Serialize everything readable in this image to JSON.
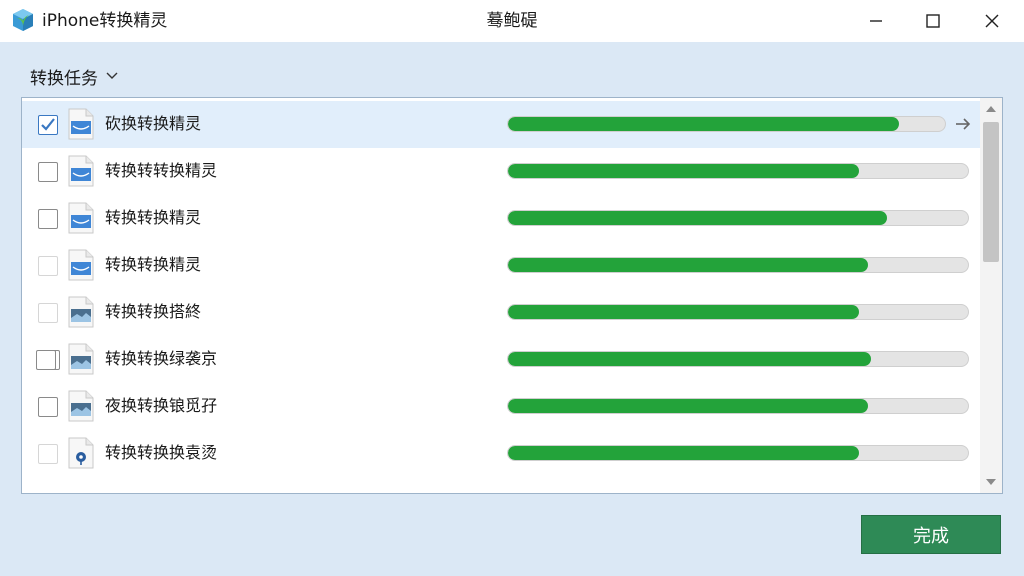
{
  "window": {
    "app_title": "iPhone转换精灵",
    "center_title": "蓦鲍碮",
    "icons": {
      "app": "app-logo-icon",
      "minimize": "minimize-icon",
      "maximize": "maximize-icon",
      "close": "close-icon"
    }
  },
  "section": {
    "label": "转换任务",
    "icon": "chevron-down-icon"
  },
  "tasks": [
    {
      "name": "砍换转换精灵",
      "progress": 0.89,
      "checked": true,
      "checkbox": "dark",
      "icon": "image-file-icon",
      "selected": true,
      "arrow": true
    },
    {
      "name": "转换转转换精灵",
      "progress": 0.76,
      "checked": false,
      "checkbox": "dark",
      "icon": "image-file-icon",
      "selected": false,
      "arrow": false
    },
    {
      "name": "转换转换精灵",
      "progress": 0.82,
      "checked": false,
      "checkbox": "dark",
      "icon": "image-file-icon",
      "selected": false,
      "arrow": false
    },
    {
      "name": "转换转换精灵",
      "progress": 0.78,
      "checked": false,
      "checkbox": "light",
      "icon": "image-file-icon",
      "selected": false,
      "arrow": false
    },
    {
      "name": "转换转换搭終",
      "progress": 0.76,
      "checked": false,
      "checkbox": "light",
      "icon": "photo-file-icon",
      "selected": false,
      "arrow": false
    },
    {
      "name": "转换转换绿袭京",
      "progress": 0.785,
      "checked": false,
      "checkbox": "stacked",
      "icon": "photo-file-icon",
      "selected": false,
      "arrow": false
    },
    {
      "name": "夜换转换锒觅孖",
      "progress": 0.78,
      "checked": false,
      "checkbox": "dark",
      "icon": "photo-file-icon",
      "selected": false,
      "arrow": false
    },
    {
      "name": "转换转换换袁烫",
      "progress": 0.76,
      "checked": false,
      "checkbox": "light",
      "icon": "document-file-icon",
      "selected": false,
      "arrow": false
    }
  ],
  "scrollbar": {
    "up_icon": "scroll-up-arrow-icon",
    "down_icon": "scroll-down-arrow-icon"
  },
  "done_button": {
    "label": "完成"
  },
  "colors": {
    "accent_green": "#23a33a",
    "button_green": "#2e8a56",
    "background": "#dbe8f5"
  }
}
